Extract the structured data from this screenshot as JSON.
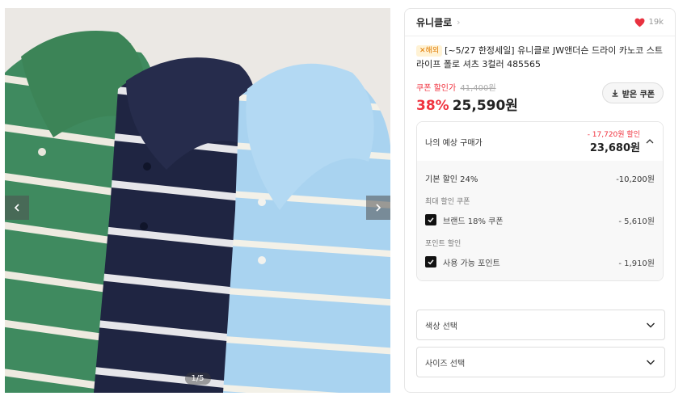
{
  "gallery": {
    "counter": "1/5",
    "prev_icon": "chevron-left-icon",
    "next_icon": "chevron-right-icon"
  },
  "brand": {
    "name": "유니클로",
    "likes": "19k",
    "heart_color": "#e8313f"
  },
  "product": {
    "badge": "✕해외",
    "title": "[~5/27 한정세일] 유니클로 JW앤더슨 드라이 카노코 스트라이프 폴로 셔츠 3컬러 485565"
  },
  "price": {
    "coupon_label": "쿠폰 할인가",
    "original": "41,400원",
    "discount_pct": "38%",
    "sale_price": "25,590원",
    "coupon_button": "받은 쿠폰",
    "accent_color": "#f0333f"
  },
  "estimate": {
    "label": "나의 예상 구매가",
    "total_discount": "- 17,720원 할인",
    "amount": "23,680원",
    "base_discount_label": "기본 할인 24%",
    "base_discount_value": "-10,200원",
    "coupon_section": "최대 할인 쿠폰",
    "coupon_item_label": "브랜드 18% 쿠폰",
    "coupon_item_value": "- 5,610원",
    "point_section": "포인트 할인",
    "point_item_label": "사용 가능 포인트",
    "point_item_value": "- 1,910원"
  },
  "options": {
    "color_placeholder": "색상 선택",
    "size_placeholder": "사이즈 선택"
  }
}
